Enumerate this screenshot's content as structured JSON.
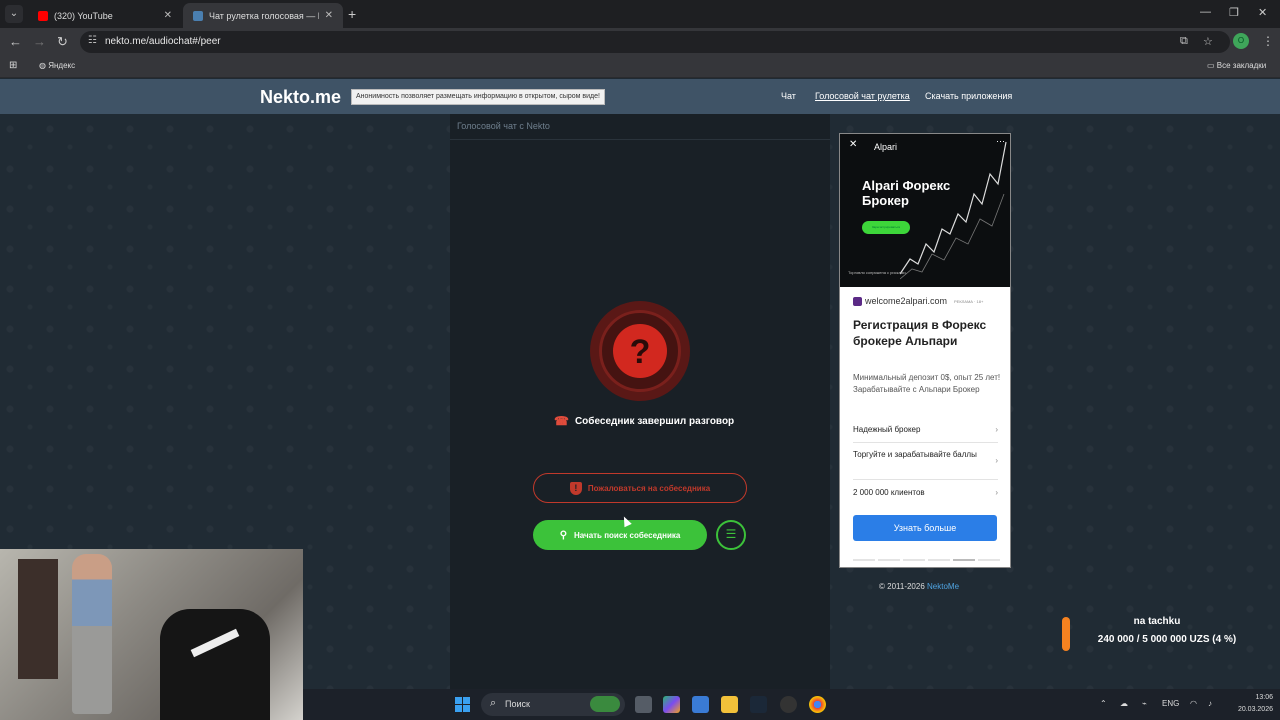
{
  "browser": {
    "tabs": [
      {
        "title": "(320) YouTube",
        "active": false
      },
      {
        "title": "Чат рулетка голосовая — Nek",
        "active": true
      }
    ],
    "url": "nekto.me/audiochat#/peer",
    "bookmarks": {
      "yandex": "Яндекс",
      "all": "Все закладки"
    },
    "profile_initial": "O"
  },
  "site": {
    "logo": "Nekto.me",
    "notice": "Анонимность позволяет размещать информацию в открытом, сыром виде!",
    "nav": [
      "Чат",
      "Голосовой чат рулетка",
      "Скачать приложения"
    ]
  },
  "chat": {
    "header": "Голосовой чат с Nekto",
    "status_symbol": "?",
    "status_text": "Собеседник завершил разговор",
    "report_button": "Пожаловаться на собеседника",
    "search_button": "Начать поиск собеседника"
  },
  "ad": {
    "brand": "Alpari",
    "headline": "Alpari Форекс Брокер",
    "cta_small": "Зарегистрироваться",
    "image_note": "Торговля сопряжена с рисками.",
    "domain": "welcome2alpari.com",
    "tag": "РЕКЛАМА · 18+",
    "title": "Регистрация в Форекс брокере Альпари",
    "description": "Минимальный депозит 0$, опыт 25 лет! Зарабатывайте с Альпари Брокер",
    "links": [
      "Надежный брокер",
      "Торгуйте и зарабатывайте баллы",
      "2 000 000 клиентов"
    ],
    "button": "Узнать больше"
  },
  "footer": {
    "copyright": "© 2011-2026",
    "link": "NektoMe"
  },
  "donation": {
    "name": "na tachku",
    "progress": "240 000 / 5 000 000 UZS (4 %)",
    "progress_fraction": 0.04,
    "accent": "#f58220"
  },
  "taskbar": {
    "search": "Поиск",
    "lang": "ENG",
    "time": "13:06",
    "date": "20.03.2026"
  },
  "colors": {
    "header_bg": "#3f5366",
    "danger": "#c0392b",
    "success": "#3cc23a",
    "ad_button": "#2b7ee7"
  }
}
